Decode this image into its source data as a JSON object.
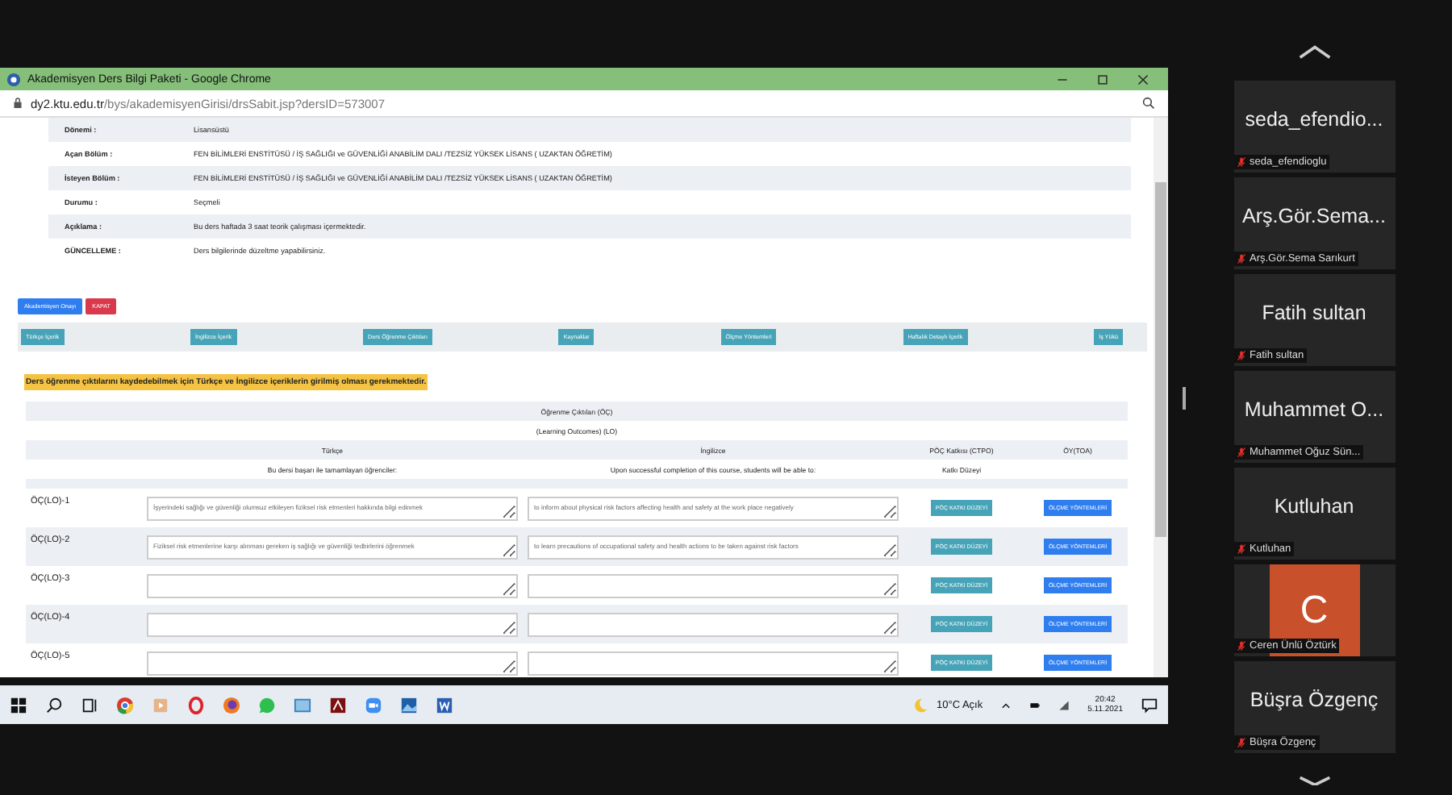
{
  "browser": {
    "title": "Akademisyen Ders Bilgi Paketi - Google Chrome",
    "url_host": "dy2.ktu.edu.tr",
    "url_path": "/bys/akademisyenGirisi/drsSabit.jsp?dersID=573007",
    "info_rows": [
      {
        "label": "Dönemi :",
        "value": "Lisansüstü"
      },
      {
        "label": "Açan Bölüm :",
        "value": "FEN BİLİMLERİ ENSTİTÜSÜ / İŞ SAĞLIĞI ve GÜVENLİĞİ ANABİLİM DALI /TEZSİZ YÜKSEK LİSANS ( UZAKTAN ÖĞRETİM)"
      },
      {
        "label": "İsteyen Bölüm :",
        "value": "FEN BİLİMLERİ ENSTİTÜSÜ / İŞ SAĞLIĞI ve GÜVENLİĞİ ANABİLİM DALI /TEZSİZ YÜKSEK LİSANS ( UZAKTAN ÖĞRETİM)"
      },
      {
        "label": "Durumu :",
        "value": "Seçmeli"
      },
      {
        "label": "Açıklama :",
        "value": "Bu ders haftada 3 saat teorik çalışması içermektedir."
      },
      {
        "label": "GÜNCELLEME :",
        "value": "Ders bilgilerinde düzeltme yapabilirsiniz."
      }
    ],
    "action_buttons": [
      {
        "label": "Akademisyen Onayı",
        "kind": "primary"
      },
      {
        "label": "KAPAT",
        "kind": "danger"
      }
    ],
    "tabs": [
      "Türkçe İçerik",
      "İngilizce İçerik",
      "Ders Öğrenme Çıktıları",
      "Kaynaklar",
      "Ölçme Yöntemleri",
      "Haftalık Detaylı İçerik",
      "İş Yükü"
    ],
    "warning": "Ders öğrenme çıktılarını kaydedebilmek için Türkçe ve İngilizce içeriklerin girilmiş olması gerekmektedir.",
    "table": {
      "title": "Öğrenme Çıktıları (ÖÇ)",
      "subtitle": "(Learning Outcomes) (LO)",
      "columns": [
        "Türkçe",
        "İngilizce",
        "PÖÇ Katkısı (CTPO)",
        "ÖY(TOA)"
      ],
      "subheaders": [
        "Bu dersi başarı ile tamamlayan öğrenciler:",
        "Upon successful completion of this course, students will be able to:",
        "Katkı Düzeyi"
      ],
      "rows": [
        {
          "label": "ÖÇ(LO)-1",
          "turkish": "İşyerindeki sağlığı ve güvenliği olumsuz etkileyen fiziksel risk etmenleri hakkında bilgi edinmek",
          "english": "to inform about physical risk factors affecting health and safety at the work place negatively",
          "contribution_button": "PÖÇ KATKI DÜZEYİ",
          "methods_button": "ÖLÇME YÖNTEMLERİ"
        },
        {
          "label": "ÖÇ(LO)-2",
          "turkish": "Fiziksel risk etmenlerine karşı alınması gereken iş sağlığı ve güvenliği tedbirlerini öğrenmek",
          "english": "to learn precautions of occupational safety and health actions to be taken against risk factors",
          "contribution_button": "PÖÇ KATKI DÜZEYİ",
          "methods_button": "ÖLÇME YÖNTEMLERİ"
        },
        {
          "label": "ÖÇ(LO)-3",
          "contribution_button": "PÖÇ KATKI DÜZEYİ",
          "methods_button": "ÖLÇME YÖNTEMLERİ"
        },
        {
          "label": "ÖÇ(LO)-4",
          "contribution_button": "PÖÇ KATKI DÜZEYİ",
          "methods_button": "ÖLÇME YÖNTEMLERİ"
        },
        {
          "label": "ÖÇ(LO)-5",
          "contribution_button": "PÖÇ KATKI DÜZEYİ",
          "methods_button": "ÖLÇME YÖNTEMLERİ"
        }
      ]
    }
  },
  "taskbar": {
    "weather": "10°C  Açık",
    "time": "20:42",
    "date": "5.11.2021"
  },
  "participants": [
    {
      "kind": "name",
      "display_name": "seda_efendio...",
      "name_label": "seda_efendioglu",
      "muted": true
    },
    {
      "kind": "name",
      "display_name": "Arş.Gör.Sema...",
      "name_label": "Arş.Gör.Sema Sarıkurt",
      "muted": true
    },
    {
      "kind": "name",
      "display_name": "Fatih sultan",
      "name_label": "Fatih sultan",
      "muted": true
    },
    {
      "kind": "name",
      "display_name": "Muhammet O...",
      "name_label": "Muhammet Oğuz Sün...",
      "muted": true
    },
    {
      "kind": "name",
      "display_name": "Kutluhan",
      "name_label": "Kutluhan",
      "muted": true
    },
    {
      "kind": "avatar",
      "initial": "C",
      "name_label": "Ceren Ünlü Öztürk",
      "muted": true
    },
    {
      "kind": "name",
      "display_name": "Büşra Özgenç",
      "name_label": "Büşra Özgenç",
      "muted": true
    }
  ]
}
